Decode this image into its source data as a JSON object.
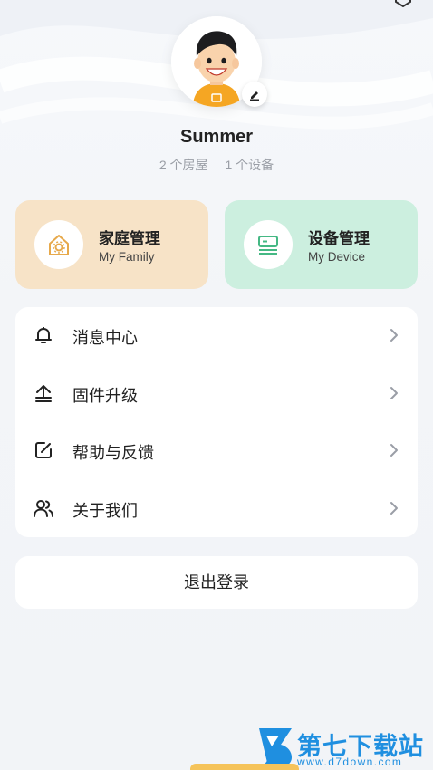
{
  "profile": {
    "name": "Summer",
    "houses": "2 个房屋",
    "devices": "1 个设备"
  },
  "cards": {
    "family": {
      "title": "家庭管理",
      "subtitle": "My Family",
      "icon": "house-gear-icon"
    },
    "device": {
      "title": "设备管理",
      "subtitle": "My Device",
      "icon": "device-icon"
    }
  },
  "menu": {
    "items": [
      {
        "label": "消息中心",
        "icon": "bell-icon"
      },
      {
        "label": "固件升级",
        "icon": "upgrade-icon"
      },
      {
        "label": "帮助与反馈",
        "icon": "edit-square-icon"
      },
      {
        "label": "关于我们",
        "icon": "users-icon"
      }
    ]
  },
  "logout": {
    "label": "退出登录"
  },
  "watermark": {
    "title": "第七下载站",
    "url": "www.d7down.com"
  },
  "colors": {
    "family_card": "#f7e3c7",
    "device_card": "#ccefdf",
    "family_icon": "#e7a94b",
    "device_icon": "#45b884",
    "watermark": "#1f8fe0"
  }
}
